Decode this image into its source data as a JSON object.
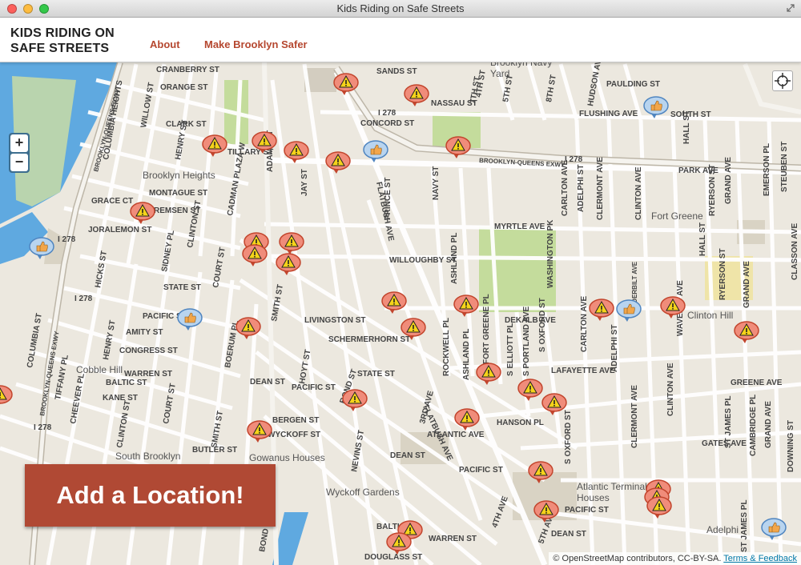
{
  "window": {
    "title": "Kids Riding on Safe Streets"
  },
  "header": {
    "brand": "KIDS RIDING ON\nSAFE STREETS",
    "nav": [
      {
        "label": "About"
      },
      {
        "label": "Make Brooklyn Safer"
      }
    ]
  },
  "map": {
    "zoom_in": "+",
    "zoom_out": "−",
    "labels": {
      "brooklyn_navy_yard": "Brooklyn Navy\nYard",
      "brooklyn_heights": "Brooklyn Heights",
      "fort_greene": "Fort Greene",
      "clinton_hill": "Clinton Hill",
      "cobble_hill": "Cobble Hill",
      "south_brooklyn": "South Brooklyn",
      "gowanus_houses": "Gowanus Houses",
      "wyckoff_gardens": "Wyckoff Gardens",
      "atlantic_terminal_houses": "Atlantic Terminal\nHouses",
      "adelphi": "Adelphi",
      "sands_st": "SANDS ST",
      "nassau_st": "NASSAU ST",
      "concord_st": "CONCORD ST",
      "tillary_st": "TILLARY ST",
      "bqe_main": "BROOKLYN-QUEENS EXWY",
      "flushing_ave": "FLUSHING AVE",
      "park_ave": "PARK AVE",
      "south_st": "SOUTH ST",
      "myrtle_ave": "MYRTLE AVE",
      "willoughby_st": "WILLOUGHBY ST",
      "dekalb_ave": "DEKALB AVE",
      "lafayette_ave": "LAFAYETTE AVE",
      "greene_ave": "GREENE AVE",
      "gates_ave": "GATES AVE",
      "hanson_pl": "HANSON PL",
      "livingston_st": "LIVINGSTON ST",
      "schermerhorn_st": "SCHERMERHORN ST",
      "state_st": "STATE ST",
      "pacific_st": "PACIFIC ST",
      "atlantic_ave": "ATLANTIC AVE",
      "dean_st": "DEAN ST",
      "bergen_st": "BERGEN ST",
      "wyckoff_st": "WYCKOFF ST",
      "warren_st": "WARREN ST",
      "baltic_st": "BALTIC ST",
      "butler_st": "BUTLER ST",
      "douglass_st": "DOUGLASS ST",
      "montague_st": "MONTAGUE ST",
      "remsen_st": "REMSEN ST",
      "joralemon_st": "JORALEMON ST",
      "grace_ct": "GRACE CT",
      "clark_st": "CLARK ST",
      "orange_st": "ORANGE ST",
      "cranberry_st": "CRANBERRY ST",
      "amity_st": "AMITY ST",
      "congress_st": "CONGRESS ST",
      "kane_st": "KANE ST",
      "flatbush_ave": "FLATBUSH AVE",
      "flatbush_ave_ext": "FLATBUSH AVE",
      "jay_st": "JAY ST",
      "adams_st": "ADAMS ST",
      "cadman_plaza": "CADMAN PLAZA W",
      "court_st": "COURT ST",
      "court_st_s": "COURT ST",
      "clinton_st": "CLINTON ST",
      "clinton_st_s": "CLINTON ST",
      "henry_st": "HENRY ST",
      "henry_st_s": "HENRY ST",
      "hicks_st": "HICKS ST",
      "sidney_pl": "SIDNEY PL",
      "boerum_pl": "BOERUM PL",
      "smith_st": "SMITH ST",
      "smith_st_n": "SMITH ST",
      "hoyt_st": "HOYT ST",
      "bond_st": "BOND ST",
      "bond_st_s": "BOND ST",
      "nevins_st": "NEVINS ST",
      "third_ave": "3RD AVE",
      "fifth_ave": "5TH AVE",
      "fourth_ave": "4TH AVE",
      "prince_st": "PRINCE ST",
      "navy_st": "NAVY ST",
      "ashland_pl": "ASHLAND PL",
      "ashland_pl_s": "ASHLAND PL",
      "rockwell_pl": "ROCKWELL PL",
      "fort_greene_pl": "FORT GREENE PL",
      "s_elliott_pl": "S ELLIOTT PL",
      "s_portland_ave": "S PORTLAND AVE",
      "s_oxford_st": "S OXFORD ST",
      "s_oxford_st_s": "S OXFORD ST",
      "washington_pk": "WASHINGTON PK",
      "carlton_ave": "CARLTON AVE",
      "carlton_ave_s": "CARLTON AVE",
      "adelphi_st": "ADELPHI ST",
      "adelphi_st_s": "ADELPHI ST",
      "clermont_ave": "CLERMONT AVE",
      "clermont_ave_s": "CLERMONT AVE",
      "vanderbilt_ave": "VANDERBILT AVE",
      "clinton_ave": "CLINTON AVE",
      "clinton_ave_s": "CLINTON AVE",
      "waverly_ave": "WAVERLY AVE",
      "hall_st": "HALL ST",
      "hall_st_n": "HALL ST",
      "ryerson_st": "RYERSON ST",
      "ryerson_st_s": "RYERSON ST",
      "grand_ave": "GRAND AVE",
      "grand_ave_s": "GRAND AVE",
      "grand_ave_bottom": "GRAND AVE",
      "emerson_pl": "EMERSON PL",
      "steuben_st": "STEUBEN ST",
      "classon_ave": "CLASSON AVE",
      "st_james_pl": "ST JAMES PL",
      "st_james_pl_s": "ST JAMES PL",
      "cambridge_pl": "CAMBRIDGE PL",
      "downing_st": "DOWNING ST",
      "seventh_st": "7TH ST",
      "fifth_st": "5TH ST",
      "eighth_st": "8TH ST",
      "fourth_st": "4TH ST",
      "plymouth": "PLYMOUTH ST",
      "paulding_st": "PAULDING ST",
      "hudson_ave": "HUDSON AVE",
      "columbia_heights": "COLUMBIA HEIGHTS",
      "willow_st": "WILLOW ST",
      "bqe_west": "BROOKLYN-QUEENS EXWY",
      "bqe_south": "BROOKLYN-QUEENS EXWY",
      "columbia_st": "COLUMBIA ST",
      "tiffany_pl": "TIFFANY PL",
      "cheever_pl": "CHEEVER PL",
      "i278_a": "I 278",
      "i278_b": "I 278",
      "i278_c": "I 278",
      "i278_d": "I 278",
      "i278_e": "I 278"
    }
  },
  "cta": {
    "label": "Add a Location!"
  },
  "attribution": {
    "text": "© OpenStreetMap contributors, CC-BY-SA.",
    "link": "Terms & Feedback"
  },
  "colors": {
    "accent": "#b04934",
    "water": "#5fa9e0",
    "park": "#c4dc9c",
    "road": "#ffffff",
    "land": "#ece8df"
  }
}
